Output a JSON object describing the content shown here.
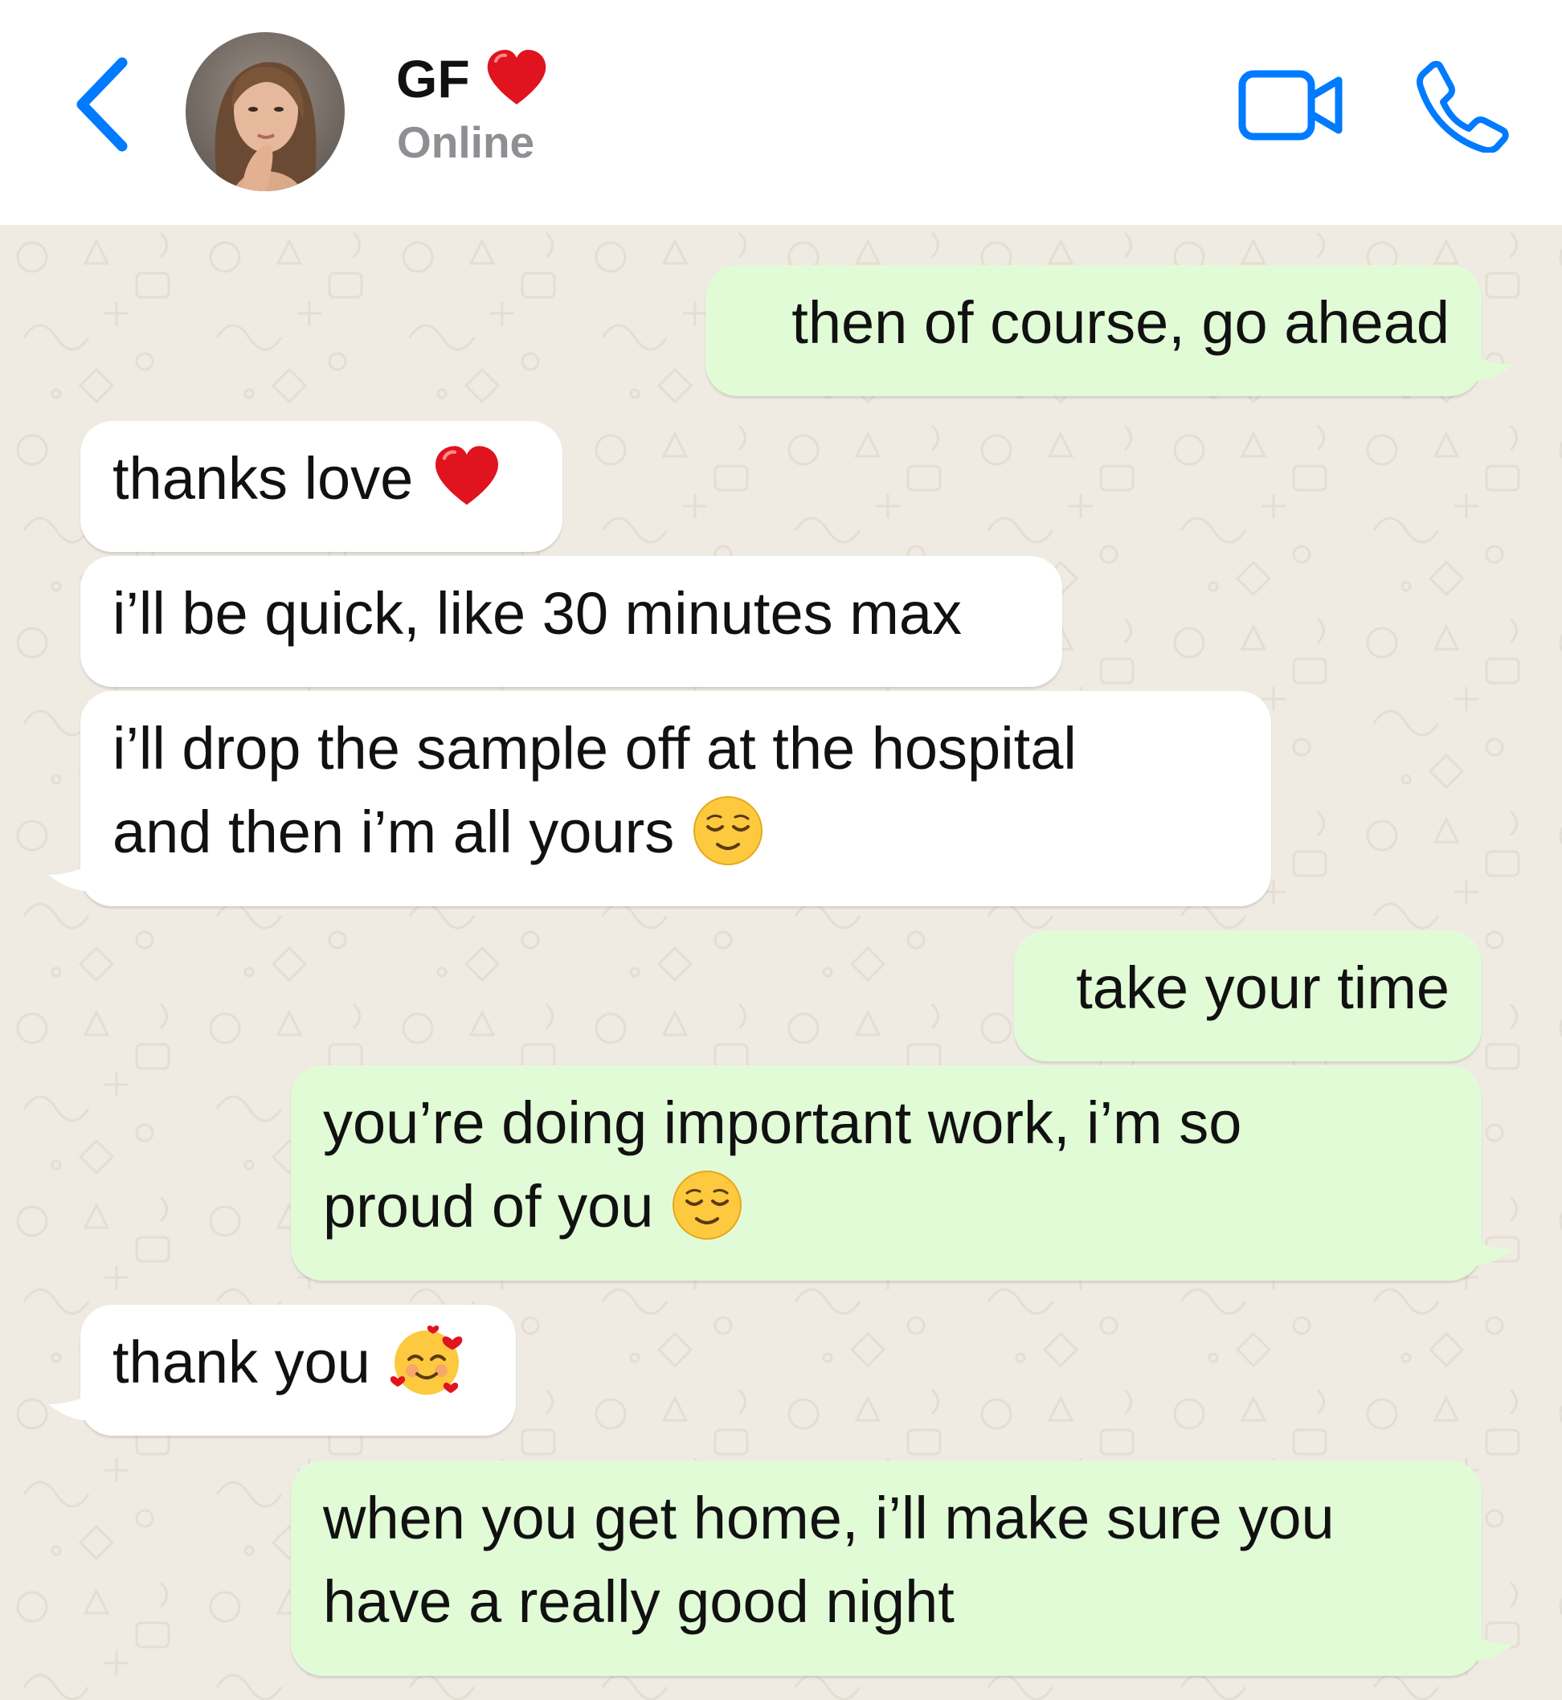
{
  "header": {
    "contact_name": "GF",
    "status": "Online"
  },
  "icons": {
    "back": "chevron-left-icon",
    "video": "video-camera-icon",
    "phone": "phone-icon",
    "heart": "red-heart-emoji",
    "relieved": "relieved-face-emoji",
    "hearts_face": "smiling-face-with-hearts-emoji"
  },
  "colors": {
    "accent": "#007aff",
    "outgoing_bubble": "#e1fbd7",
    "incoming_bubble": "#ffffff",
    "chat_background": "#efeae2",
    "status_text": "#8e8e93"
  },
  "messages": [
    {
      "direction": "outgoing",
      "lines": [
        "then of course, go ahead"
      ]
    },
    {
      "direction": "incoming",
      "lines": [
        "thanks love"
      ],
      "emoji": "red-heart-emoji"
    },
    {
      "direction": "incoming",
      "lines": [
        "i’ll be quick, like 30 minutes max"
      ]
    },
    {
      "direction": "incoming",
      "lines": [
        "i’ll drop the sample off at the hospital",
        "and then i’m all yours"
      ],
      "emoji": "relieved-face-emoji"
    },
    {
      "direction": "outgoing",
      "lines": [
        "take your time"
      ]
    },
    {
      "direction": "outgoing",
      "lines": [
        "you’re doing important work, i’m so",
        "proud of you"
      ],
      "emoji": "relieved-face-emoji"
    },
    {
      "direction": "incoming",
      "lines": [
        "thank you"
      ],
      "emoji": "smiling-face-with-hearts-emoji"
    },
    {
      "direction": "outgoing",
      "lines": [
        "when you get home, i’ll make sure you",
        "have a really good night"
      ]
    }
  ]
}
